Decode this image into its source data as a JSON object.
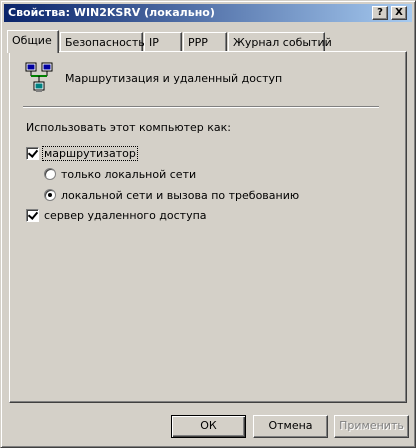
{
  "window": {
    "title": "Свойства: WIN2KSRV (локально)",
    "help_label": "?",
    "close_label": "X"
  },
  "tabs": [
    {
      "label": "Общие",
      "active": true
    },
    {
      "label": "Безопасность",
      "active": false
    },
    {
      "label": "IP",
      "active": false
    },
    {
      "label": "PPP",
      "active": false
    },
    {
      "label": "Журнал событий",
      "active": false
    }
  ],
  "general": {
    "service_name": "Маршрутизация и удаленный доступ",
    "icon": "network-computers-icon",
    "use_as_label": "Использовать этот компьютер как:",
    "router_label": "маршрутизатор",
    "router_checked": true,
    "lan_only_label": "только локальной сети",
    "lan_only_checked": false,
    "lan_demand_label": "локальной сети и вызова по требованию",
    "lan_demand_checked": true,
    "ras_label": "сервер удаленного доступа",
    "ras_checked": true
  },
  "buttons": {
    "ok": "ОК",
    "cancel": "Отмена",
    "apply": "Применить"
  },
  "colors": {
    "title_start": "#0a246a",
    "title_end": "#a6caf0",
    "face": "#d4d0c8"
  }
}
